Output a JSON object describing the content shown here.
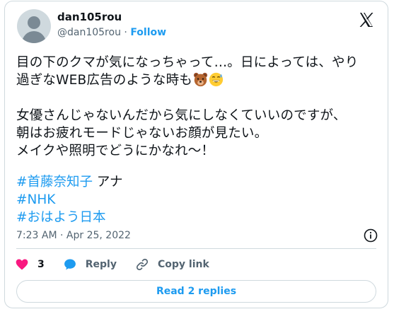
{
  "author": {
    "display_name": "dan105rou",
    "handle": "@dan105rou",
    "follow_label": "Follow"
  },
  "tweet": {
    "line1": "目の下のクマが気になっちゃって…。日によっては、やり",
    "line2": "過ぎなWEB広告のような時も",
    "para2": "女優さんじゃないんだから気にしなくていいのですが、\n朝はお疲れモードじゃないお顔が見たい。\nメイクや照明でどうにかなれ〜！",
    "hashtags": [
      "#首藤奈知子",
      "#NHK",
      "#おはよう日本"
    ],
    "hashtag1_suffix": " アナ"
  },
  "meta": {
    "time": "7:23 AM",
    "separator": " · ",
    "date": "Apr 25, 2022"
  },
  "actions": {
    "like_count": "3",
    "reply_label": "Reply",
    "copy_link_label": "Copy link"
  },
  "read_replies_label": "Read 2 replies",
  "icons": [
    "x-logo-icon",
    "bear-emoji-icon",
    "sweat-smile-emoji-icon",
    "info-icon",
    "heart-icon",
    "reply-bubble-icon",
    "link-icon"
  ],
  "colors": {
    "accent": "#1d9bf0",
    "like": "#f91880",
    "text": "#0f1419",
    "muted": "#536471",
    "border": "#cfd9de"
  }
}
